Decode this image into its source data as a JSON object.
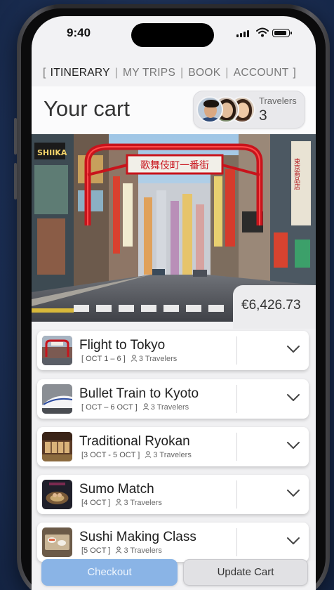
{
  "status_bar": {
    "time": "9:40"
  },
  "nav": {
    "tabs": [
      {
        "label": "ITINERARY",
        "active": true
      },
      {
        "label": "MY TRIPS",
        "active": false
      },
      {
        "label": "BOOK",
        "active": false
      },
      {
        "label": "ACCOUNT",
        "active": false
      }
    ]
  },
  "header": {
    "title": "Your cart",
    "travelers_label": "Travelers",
    "travelers_count": "3"
  },
  "hero": {
    "gate_sign": "歌舞伎町一番街",
    "signs": [
      "SHIIKA",
      "東京商品店",
      "東京商品店"
    ]
  },
  "cart": {
    "total": "€6,426.73",
    "items": [
      {
        "title": "Flight to Tokyo",
        "dates": "[ OCT 1 – 6 ]",
        "travelers": "3 Travelers",
        "thumb": "tokyo-gate"
      },
      {
        "title": "Bullet Train to Kyoto",
        "dates": "[ OCT – 6 OCT ]",
        "travelers": "3 Travelers",
        "thumb": "bullet-train"
      },
      {
        "title": "Traditional Ryokan",
        "dates": "[3 OCT - 5 OCT ]",
        "travelers": "3 Travelers",
        "thumb": "ryokan"
      },
      {
        "title": "Sumo Match",
        "dates": "[4 OCT ]",
        "travelers": "3 Travelers",
        "thumb": "sumo"
      },
      {
        "title": "Sushi Making Class",
        "dates": "[5 OCT ]",
        "travelers": "3 Travelers",
        "thumb": "sushi"
      }
    ]
  },
  "actions": {
    "checkout_label": "Checkout",
    "update_label": "Update Cart"
  },
  "colors": {
    "accent": "#8ab4e6",
    "background": "#1d3158",
    "gate_red": "#c8141c"
  }
}
